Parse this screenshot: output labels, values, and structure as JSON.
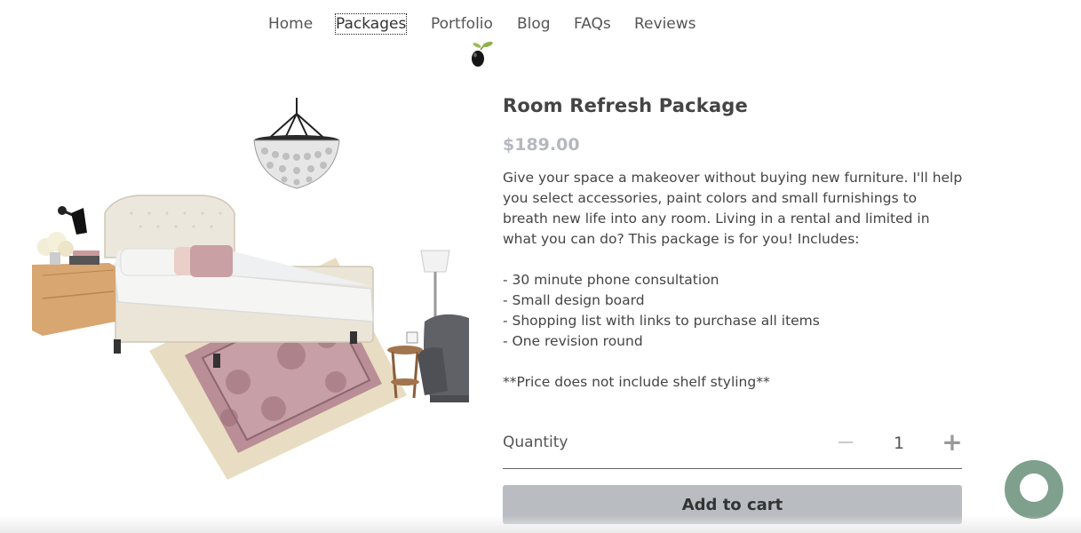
{
  "nav": {
    "items": [
      {
        "label": "Home"
      },
      {
        "label": "Packages"
      },
      {
        "label": "Portfolio"
      },
      {
        "label": "Blog"
      },
      {
        "label": "FAQs"
      },
      {
        "label": "Reviews"
      }
    ],
    "active": "Packages",
    "logo_icon": "olive-branch-icon"
  },
  "product": {
    "title": "Room Refresh Package",
    "price": "$189.00",
    "description": [
      "Give your space a makeover without buying new furniture. I'll help you select accessories, paint colors and small furnishings to breath new life into any room. Living in a rental and limited in what you can do? This package is for you! Includes:",
      "",
      "- 30 minute phone consultation",
      "- Small design board",
      "- Shopping list with links to purchase all items",
      "- One revision round",
      "",
      "**Price does not include shelf styling**"
    ],
    "image_icon": "bedroom-moodboard-image"
  },
  "quantity": {
    "label": "Quantity",
    "value": "1",
    "minus_symbol": "−",
    "plus_symbol": "+"
  },
  "cart": {
    "add_label": "Add to cart"
  },
  "chat": {
    "icon": "chat-bubble-icon"
  },
  "colors": {
    "chat_button": "#7fa08c",
    "add_button": "#b9bdc2",
    "price": "#b5b8bd"
  }
}
